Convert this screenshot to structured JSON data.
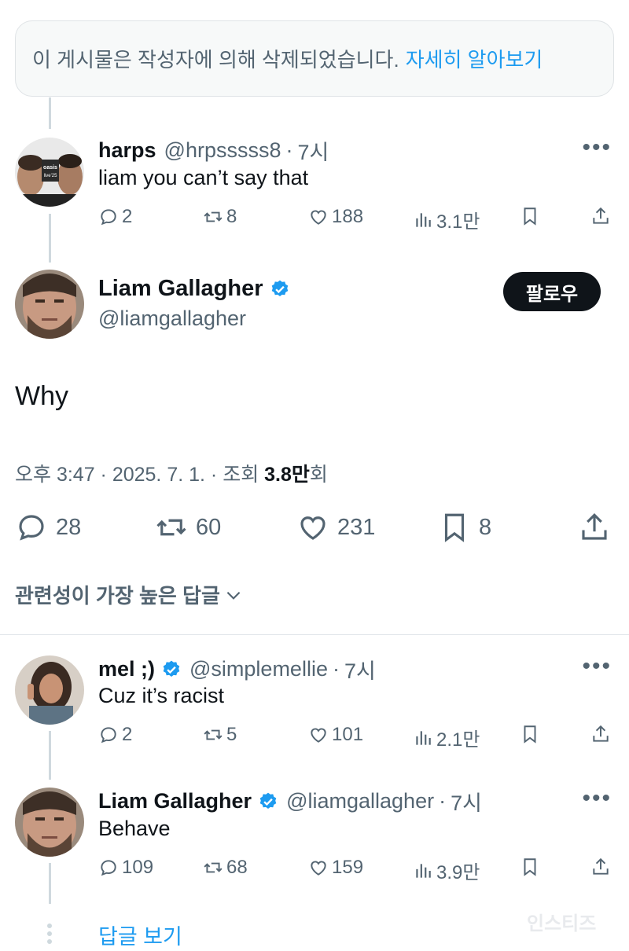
{
  "deleted_notice": {
    "text": "이 게시물은 작성자에 의해 삭제되었습니다.",
    "link": "자세히 알아보기"
  },
  "reply1": {
    "name": "harps",
    "handle": "@hrpsssss8",
    "time": "7시",
    "text": "liam you can’t say that",
    "replies": "2",
    "reposts": "8",
    "likes": "188",
    "views": "3.1만",
    "avatar_text": "oasis live'25"
  },
  "main_tweet": {
    "name": "Liam Gallagher",
    "handle": "@liamgallagher",
    "follow_label": "팔로우",
    "text": "Why",
    "meta_time": "오후 3:47 · 2025. 7. 1. · 조회 ",
    "meta_views": "3.8만",
    "meta_views_suffix": "회",
    "replies": "28",
    "reposts": "60",
    "likes": "231",
    "bookmarks": "8"
  },
  "sort_label": "관련성이 가장 높은 답글",
  "reply2": {
    "name": "mel ;)",
    "handle": "@simplemellie",
    "time": "7시",
    "text": "Cuz it’s racist",
    "replies": "2",
    "reposts": "5",
    "likes": "101",
    "views": "2.1만"
  },
  "reply3": {
    "name": "Liam Gallagher",
    "handle": "@liamgallagher",
    "time": "7시",
    "text": "Behave",
    "replies": "109",
    "reposts": "68",
    "likes": "159",
    "views": "3.9만"
  },
  "show_replies": "답글 보기",
  "watermark": "인스티즈",
  "colors": {
    "accent": "#1d9bf0",
    "text": "#0f1419",
    "muted": "#536471"
  }
}
